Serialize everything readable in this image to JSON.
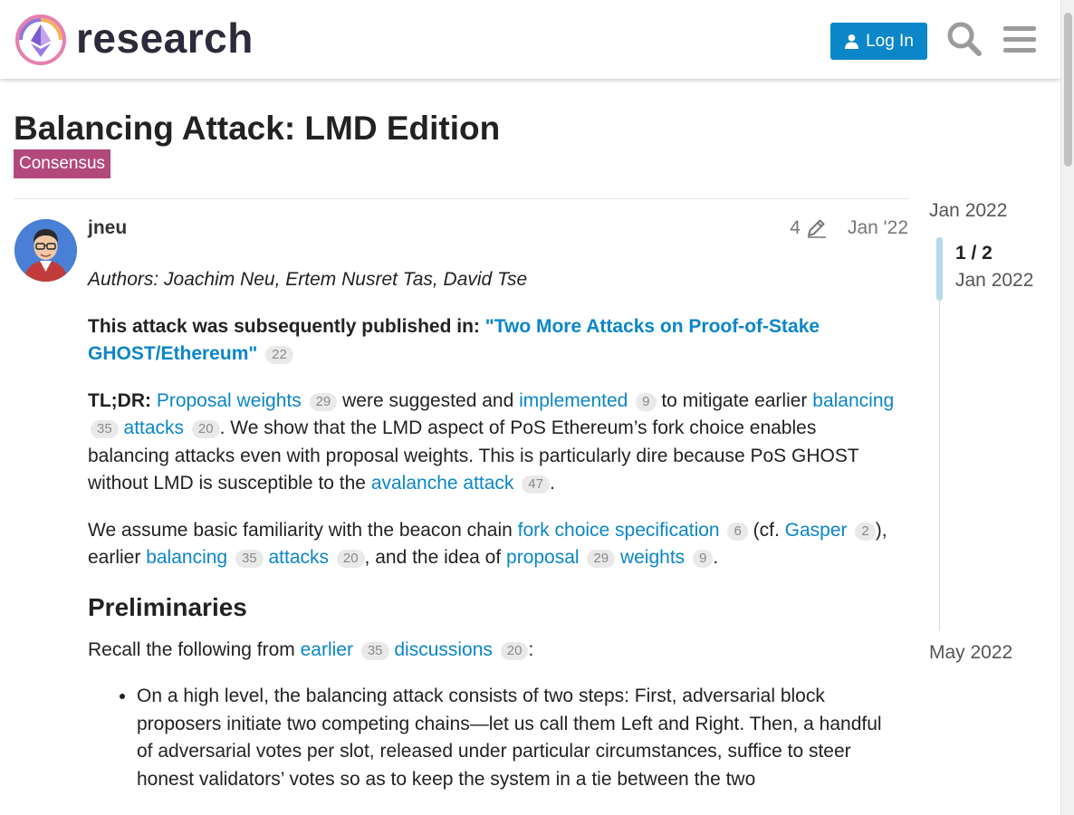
{
  "header": {
    "site_name": "research",
    "login_label": "Log In"
  },
  "topic": {
    "title": "Balancing Attack: LMD Edition",
    "category": "Consensus",
    "category_color": "#b3487c"
  },
  "post": {
    "username": "jneu",
    "edit_count": "4",
    "date": "Jan '22",
    "authors": "Authors: Joachim Neu, Ertem Nusret Tas, David Tse",
    "pub_prefix": "This attack was subsequently published in: ",
    "pub_link": "\"Two More Attacks on Proof-of-Stake GHOST/Ethereum\"",
    "pub_count": "22",
    "tldr_label": "TL;DR:",
    "tldr_link1": "Proposal weights",
    "tldr_count1": "29",
    "tldr_text1": " were suggested and ",
    "tldr_link2": "implemented",
    "tldr_count2": "9",
    "tldr_text2": " to mitigate earlier ",
    "tldr_link3": "balancing",
    "tldr_count3": "35",
    "tldr_link4": "attacks",
    "tldr_count4": "20",
    "tldr_text3": ". We show that the LMD aspect of PoS Ethereum’s fork choice enables balancing attacks even with proposal weights. This is particularly dire because PoS GHOST without LMD is susceptible to the ",
    "tldr_link5": "avalanche attack",
    "tldr_count5": "47",
    "tldr_text4": ".",
    "assume_text1": "We assume basic familiarity with the beacon chain ",
    "assume_link1": "fork choice specification",
    "assume_count1": "6",
    "assume_text2": " (cf. ",
    "assume_link2": "Gasper",
    "assume_count2": "2",
    "assume_text3": "), earlier ",
    "assume_link3": "balancing",
    "assume_count3": "35",
    "assume_link4": "attacks",
    "assume_count4": "20",
    "assume_text4": ", and the idea of ",
    "assume_link5": "proposal",
    "assume_count5": "29",
    "assume_link6": "weights",
    "assume_count6": "9",
    "assume_text5": ".",
    "prelim_heading": "Preliminaries",
    "recall_text1": "Recall the following from ",
    "recall_link1": "earlier",
    "recall_count1": "35",
    "recall_link2": "discussions",
    "recall_count2": "20",
    "recall_text2": ":",
    "bullet1": "On a high level, the balancing attack consists of two steps: First, adversarial block proposers initiate two competing chains—let us call them Left and Right. Then, a handful of adversarial votes per slot, released under particular circumstances, suffice to steer honest validators’ votes so as to keep the system in a tie between the two"
  },
  "timeline": {
    "start": "Jan 2022",
    "position": "1 / 2",
    "position_date": "Jan 2022",
    "end": "May 2022"
  },
  "colors": {
    "link": "#0a86c9",
    "button": "#0a86c9",
    "badge_bg": "#e9e9e9"
  }
}
